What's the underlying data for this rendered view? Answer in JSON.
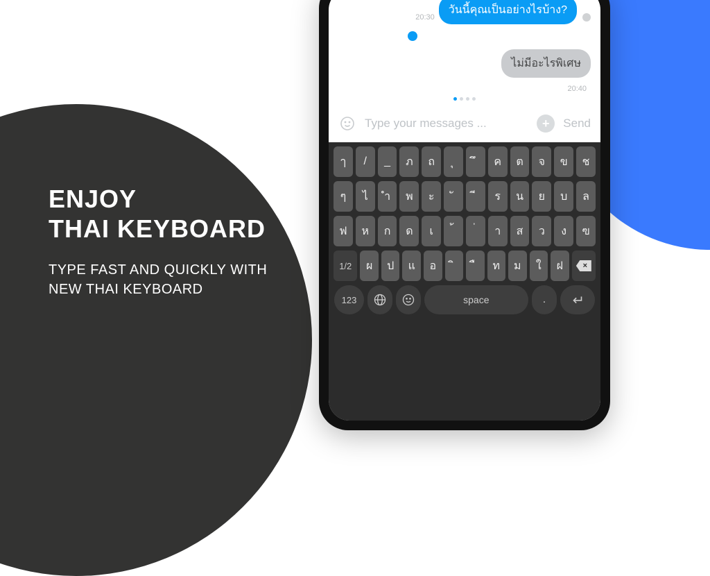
{
  "headline": {
    "title_l1": "ENJOY",
    "title_l2": "THAI KEYBOARD",
    "sub_l1": "TYPE FAST AND QUICKLY WITH",
    "sub_l2": "NEW THAI KEYBOARD"
  },
  "chat": {
    "msg1": "วันนี้คุณเป็นอย่างไรบ้าง?",
    "time1": "20:30",
    "msg2": "ไม่มีอะไรพิเศษ",
    "time2": "20:40"
  },
  "input": {
    "placeholder": "Type your messages ...",
    "send": "Send"
  },
  "keys": {
    "r1": [
      "ๅ",
      "/",
      "_",
      "ภ",
      "ถ",
      "ุ",
      "ึ",
      "ค",
      "ต",
      "จ",
      "ข",
      "ช"
    ],
    "r2": [
      "ๆ",
      "ไ",
      "ำ",
      "พ",
      "ะ",
      "ั",
      "ี",
      "ร",
      "น",
      "ย",
      "บ",
      "ล"
    ],
    "r3": [
      "ฟ",
      "ห",
      "ก",
      "ด",
      "เ",
      "้",
      "่",
      "า",
      "ส",
      "ว",
      "ง",
      "ฃ"
    ],
    "r4_switch": "1/2",
    "r4": [
      "ผ",
      "ป",
      "แ",
      "อ",
      "ิ",
      "ื",
      "ท",
      "ม",
      "ใ",
      "ฝ"
    ],
    "r5_123": "123",
    "r5_space": "space",
    "r5_period": "."
  }
}
